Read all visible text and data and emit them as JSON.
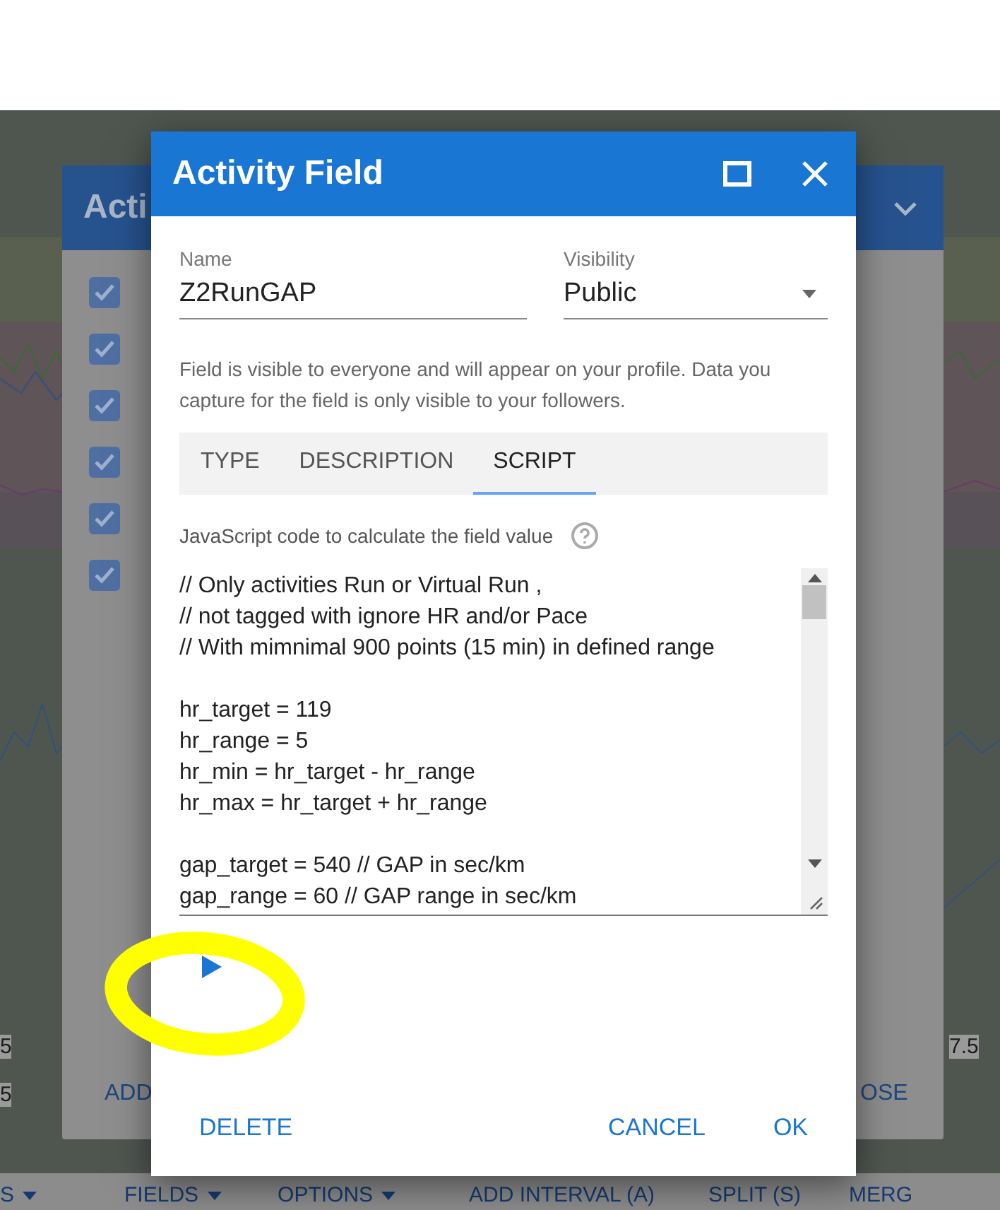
{
  "background": {
    "panel_title": "Acti",
    "checkboxes": [
      {
        "checked": true
      },
      {
        "checked": true
      },
      {
        "checked": true
      },
      {
        "checked": true
      },
      {
        "checked": true
      },
      {
        "checked": true
      }
    ],
    "axis_labels": [
      "5",
      "7.5",
      "5"
    ],
    "panel_buttons": [
      "ADD",
      "OSE"
    ],
    "toolbar": [
      {
        "label": "S",
        "dropdown": true
      },
      {
        "label": "FIELDS",
        "dropdown": true
      },
      {
        "label": "OPTIONS",
        "dropdown": true
      },
      {
        "label": "ADD INTERVAL (A)",
        "dropdown": false
      },
      {
        "label": "SPLIT (S)",
        "dropdown": false
      },
      {
        "label": "MERG",
        "dropdown": false
      }
    ]
  },
  "dialog": {
    "title": "Activity Field",
    "name": {
      "label": "Name",
      "value": "Z2RunGAP"
    },
    "visibility": {
      "label": "Visibility",
      "value": "Public"
    },
    "visibility_note": "Field is visible to everyone and will appear on your profile. Data you capture for the field is only visible to your followers.",
    "tabs": [
      {
        "label": "TYPE",
        "selected": false
      },
      {
        "label": "DESCRIPTION",
        "selected": false
      },
      {
        "label": "SCRIPT",
        "selected": true
      }
    ],
    "script_label": "JavaScript code to calculate the field value",
    "script_blocks": [
      [
        "// Only activities Run or Virtual Run ,",
        "// not tagged with ignore HR and/or Pace",
        "// With mimnimal 900 points (15 min) in defined range"
      ],
      [
        "hr_target = 119",
        "hr_range = 5",
        "hr_min = hr_target - hr_range",
        "hr_max = hr_target + hr_range"
      ],
      [
        "gap_target = 540 // GAP in sec/km",
        "gap_range = 60 // GAP range in sec/km"
      ]
    ],
    "buttons": [
      {
        "label": "DELETE",
        "kind": "left"
      },
      {
        "label": "CANCEL",
        "kind": "right"
      },
      {
        "label": "OK",
        "kind": "right"
      }
    ]
  },
  "annotation": {
    "kind": "ellipse",
    "color": "#ffff00"
  }
}
